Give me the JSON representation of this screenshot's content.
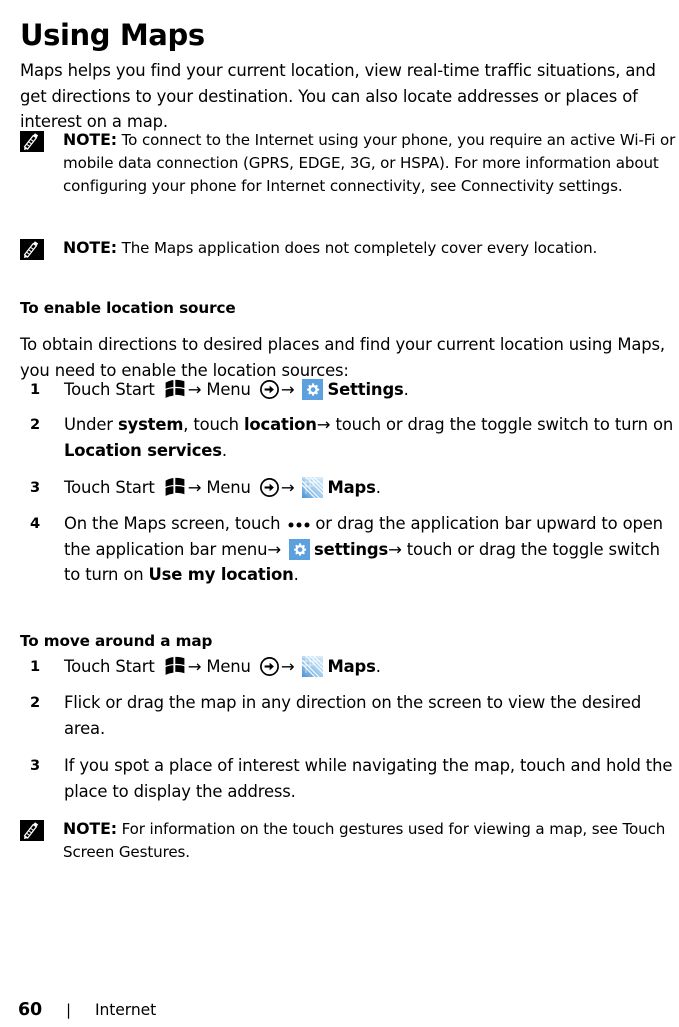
{
  "document": {
    "title": "Using Maps",
    "intro_paragraph": "Maps helps you find your current location, view real-time traffic situations, and get directions to your destination. You can also locate addresses or places of interest on a map."
  },
  "notes": [
    {
      "label": "NOTE:",
      "icon": "note-pencil-icon",
      "text": " To connect to the Internet using your phone, you require an active Wi-Fi or mobile data connection (GPRS, EDGE, 3G, or HSPA). For more information about configuring your phone for Internet connectivity, see Connectivity settings."
    },
    {
      "label": "NOTE:",
      "icon": "note-pencil-icon",
      "text": " The Maps application does not completely cover every location."
    },
    {
      "label": "NOTE:",
      "icon": "note-pencil-icon",
      "text": " For information on the touch gestures used for viewing a map, see Touch Screen Gestures."
    }
  ],
  "sections": [
    {
      "heading": "To enable location source",
      "lead_paragraph": "To obtain directions to desired places and find your current location using Maps, you need to enable the location sources:",
      "steps": [
        {
          "number": "1",
          "parts": [
            {
              "type": "text",
              "value": "Touch Start "
            },
            {
              "type": "icon",
              "value": "windows-start-icon"
            },
            {
              "type": "text",
              "value": "→ Menu "
            },
            {
              "type": "icon",
              "value": "menu-arrow-circle-icon"
            },
            {
              "type": "text",
              "value": "→ "
            },
            {
              "type": "icon",
              "value": "settings-tile-icon"
            },
            {
              "type": "bold",
              "value": "Settings"
            },
            {
              "type": "text",
              "value": "."
            }
          ]
        },
        {
          "number": "2",
          "parts": [
            {
              "type": "text",
              "value": "Under "
            },
            {
              "type": "bold",
              "value": "system"
            },
            {
              "type": "text",
              "value": ", touch "
            },
            {
              "type": "bold",
              "value": "location"
            },
            {
              "type": "text",
              "value": "→ touch or drag the toggle switch to turn on "
            },
            {
              "type": "bold",
              "value": "Location services"
            },
            {
              "type": "text",
              "value": "."
            }
          ]
        },
        {
          "number": "3",
          "parts": [
            {
              "type": "text",
              "value": "Touch Start "
            },
            {
              "type": "icon",
              "value": "windows-start-icon"
            },
            {
              "type": "text",
              "value": "→ Menu "
            },
            {
              "type": "icon",
              "value": "menu-arrow-circle-icon"
            },
            {
              "type": "text",
              "value": "→ "
            },
            {
              "type": "icon",
              "value": "maps-tile-icon"
            },
            {
              "type": "bold",
              "value": "Maps"
            },
            {
              "type": "text",
              "value": "."
            }
          ]
        },
        {
          "number": "4",
          "parts": [
            {
              "type": "text",
              "value": "On the Maps screen, touch "
            },
            {
              "type": "icon",
              "value": "ellipsis-icon"
            },
            {
              "type": "text",
              "value": "or drag the application bar upward to open the application bar menu→ "
            },
            {
              "type": "icon",
              "value": "settings-tile-icon"
            },
            {
              "type": "bold",
              "value": "settings"
            },
            {
              "type": "text",
              "value": "→ touch or drag the toggle switch to turn on "
            },
            {
              "type": "bold",
              "value": "Use my location"
            },
            {
              "type": "text",
              "value": "."
            }
          ]
        }
      ]
    },
    {
      "heading": "To move around a map",
      "lead_paragraph": "",
      "steps": [
        {
          "number": "1",
          "parts": [
            {
              "type": "text",
              "value": "Touch Start "
            },
            {
              "type": "icon",
              "value": "windows-start-icon"
            },
            {
              "type": "text",
              "value": "→ Menu "
            },
            {
              "type": "icon",
              "value": "menu-arrow-circle-icon"
            },
            {
              "type": "text",
              "value": "→ "
            },
            {
              "type": "icon",
              "value": "maps-tile-icon"
            },
            {
              "type": "bold",
              "value": "Maps"
            },
            {
              "type": "text",
              "value": "."
            }
          ]
        },
        {
          "number": "2",
          "parts": [
            {
              "type": "text",
              "value": "Flick or drag the map in any direction on the screen to view the desired area."
            }
          ]
        },
        {
          "number": "3",
          "parts": [
            {
              "type": "text",
              "value": "If you spot a place of interest while navigating the map, touch and hold the place to display the address."
            }
          ]
        }
      ]
    }
  ],
  "steps_text": {
    "s1_1_a": "Touch Start ",
    "s1_1_b": "→ Menu ",
    "s1_1_c": "→ ",
    "s1_1_settings": "Settings",
    "s1_1_period": ".",
    "s1_2_a": "Under ",
    "s1_2_system": "system",
    "s1_2_b": ", touch ",
    "s1_2_location": "location",
    "s1_2_c": "→ touch or drag the toggle switch to turn on ",
    "s1_2_locsvc": "Location services",
    "s1_2_period": ".",
    "s1_3_a": "Touch Start ",
    "s1_3_b": "→ Menu ",
    "s1_3_c": "→ ",
    "s1_3_maps": "Maps",
    "s1_3_period": ".",
    "s1_4_a": "On the Maps screen, touch ",
    "s1_4_b": "or drag the application bar upward to open the application bar menu→ ",
    "s1_4_settings": "settings",
    "s1_4_c": "→ touch or drag the toggle switch to turn on ",
    "s1_4_useloc": "Use my location",
    "s1_4_period": ".",
    "s2_1_a": "Touch Start ",
    "s2_1_b": "→ Menu ",
    "s2_1_c": "→ ",
    "s2_1_maps": "Maps",
    "s2_1_period": ".",
    "s2_2": "Flick or drag the map in any direction on the screen to view the desired area.",
    "s2_3": "If you spot a place of interest while navigating the map, touch and hold the place to display the address."
  },
  "footer": {
    "page_number": "60",
    "separator": "|",
    "chapter": "Internet"
  },
  "colors": {
    "settings_tile": "#5ca0dd",
    "maps_tile": "#8fc2ea",
    "text": "#000000",
    "background": "#ffffff",
    "note_icon_bg": "#000000"
  }
}
